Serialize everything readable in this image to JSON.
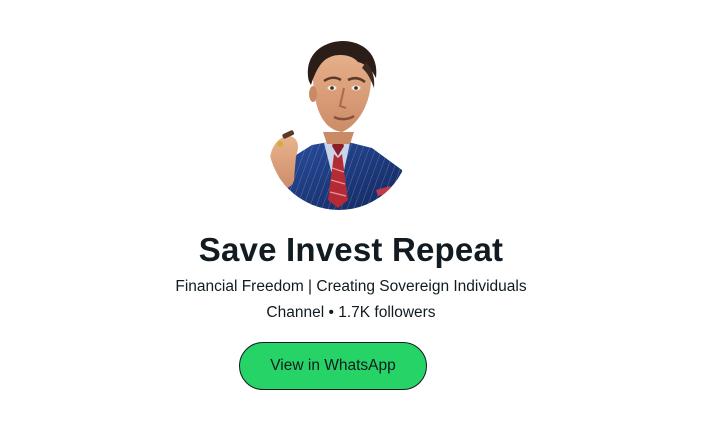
{
  "channel": {
    "name": "Save Invest Repeat",
    "description": "Financial Freedom | Creating Sovereign Individuals",
    "meta": "Channel • 1.7K followers",
    "avatar_icon": "channel-avatar-image"
  },
  "actions": {
    "view_button_label": "View in WhatsApp"
  },
  "colors": {
    "button_green": "#25d366",
    "text_dark": "#111b21"
  }
}
